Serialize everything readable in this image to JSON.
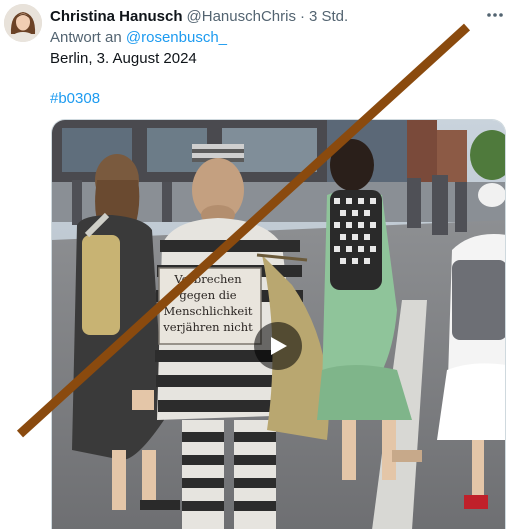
{
  "tweet": {
    "author_name": "Christina Hanusch",
    "author_handle": "@HanuschChris",
    "separator": "·",
    "time": "3 Std.",
    "reply_prefix": "Antwort an",
    "reply_handle": "@rosenbusch_",
    "body_text": "Berlin, 3. August 2024",
    "hashtag": "#b0308"
  },
  "media": {
    "type": "video",
    "sign_lines": [
      "Verbrechen",
      "gegen die",
      "Menschlichkeit",
      "verjähren nicht"
    ]
  },
  "icons": {
    "more": "more-horizontal-icon",
    "play": "play-icon",
    "overlay": "diagonal-strike-line"
  },
  "colors": {
    "link": "#1d9bf0",
    "secondary_text": "#536471",
    "strike_line": "#8a4a0e"
  }
}
